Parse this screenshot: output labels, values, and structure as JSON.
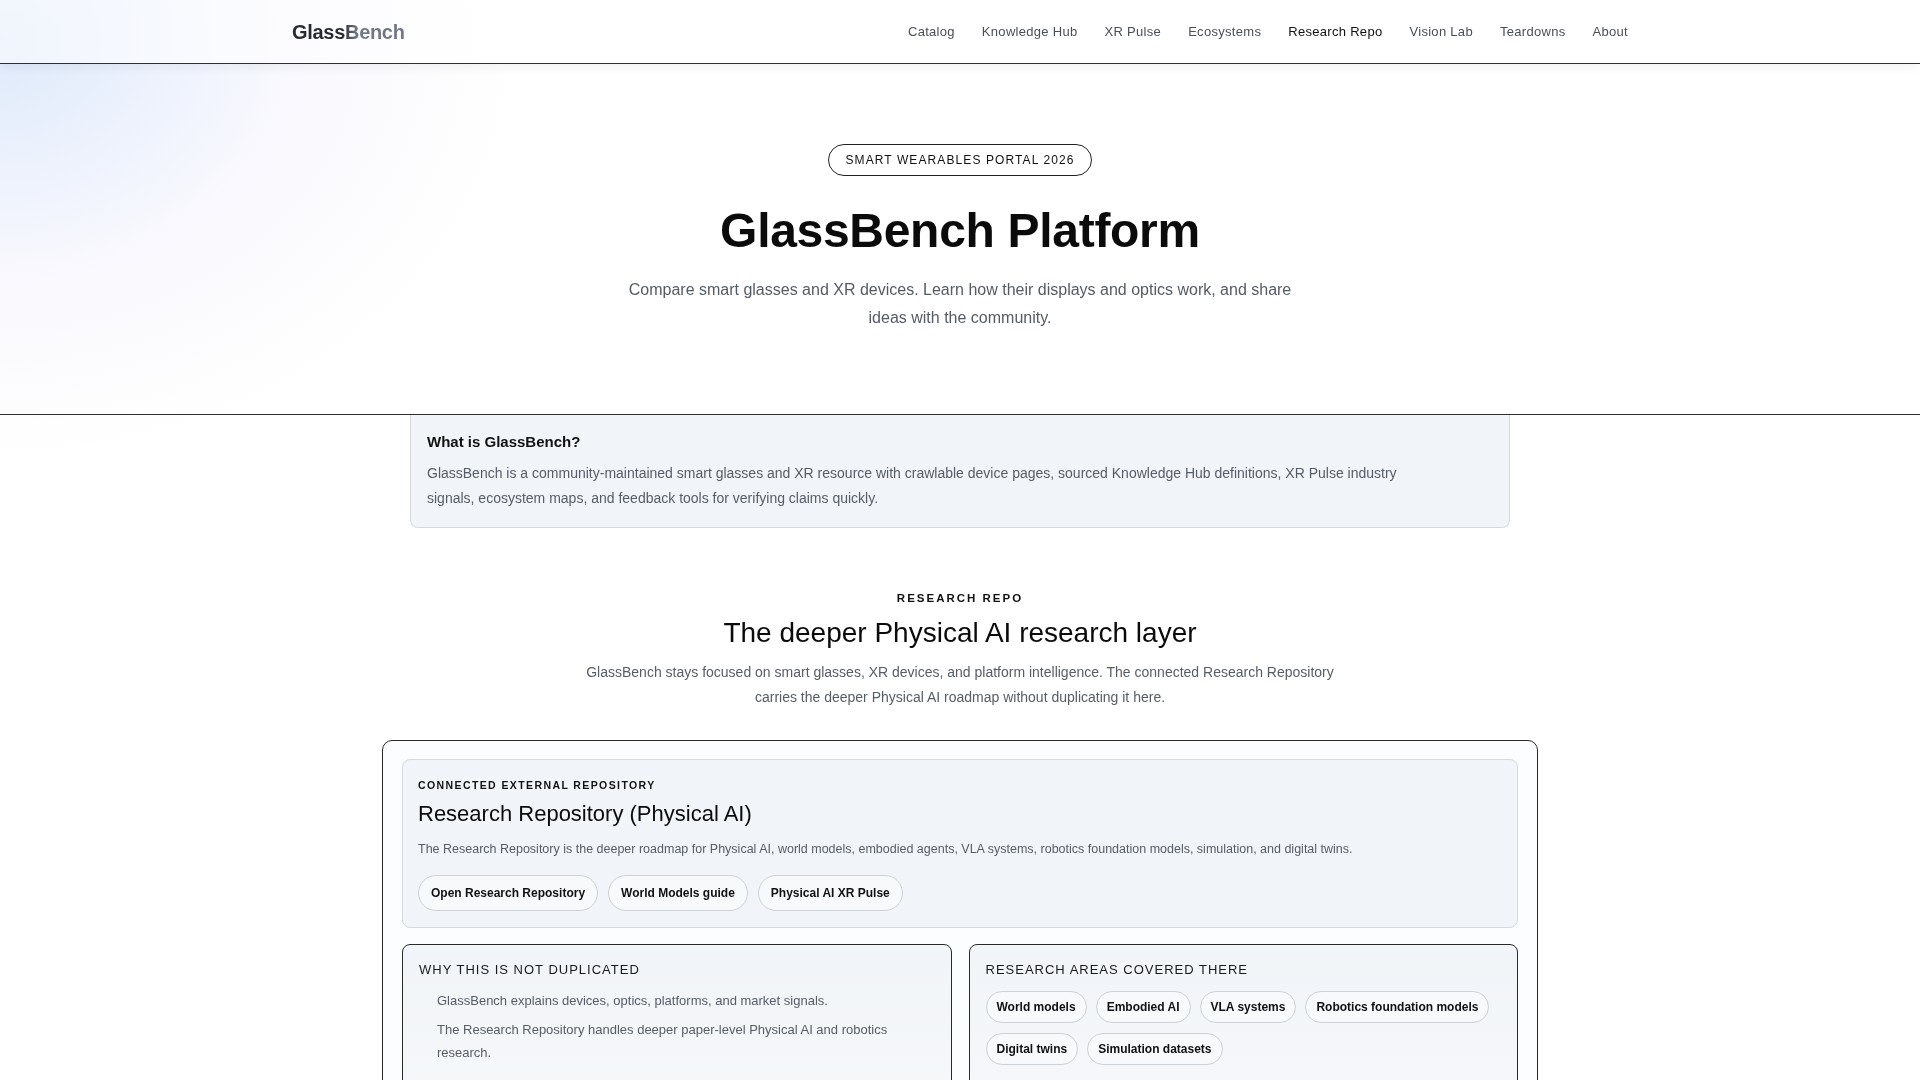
{
  "header": {
    "logo": "GlassBench",
    "nav": [
      {
        "label": "Catalog",
        "selected": false
      },
      {
        "label": "Knowledge Hub",
        "selected": false
      },
      {
        "label": "XR Pulse",
        "selected": false
      },
      {
        "label": "Ecosystems",
        "selected": false
      },
      {
        "label": "Research Repo",
        "selected": true
      },
      {
        "label": "Vision Lab",
        "selected": false
      },
      {
        "label": "Teardowns",
        "selected": false
      },
      {
        "label": "About",
        "selected": false
      }
    ]
  },
  "hero": {
    "badge": "SMART WEARABLES PORTAL 2026",
    "title": "GlassBench Platform",
    "subtitle": "Compare smart glasses and XR devices. Learn how their displays and optics work, and share ideas with the community."
  },
  "intro_card": {
    "title": "What is GlassBench?",
    "body": "GlassBench is a community-maintained smart glasses and XR resource with crawlable device pages, sourced Knowledge Hub definitions, XR Pulse industry signals, ecosystem maps, and feedback tools for verifying claims quickly."
  },
  "research_section": {
    "eyebrow": "RESEARCH REPO",
    "title": "The deeper Physical AI research layer",
    "description": "GlassBench stays focused on smart glasses, XR devices, and platform intelligence. The connected Research Repository carries the deeper Physical AI roadmap without duplicating it here.",
    "repository_card": {
      "eyebrow": "CONNECTED EXTERNAL REPOSITORY",
      "title": "Research Repository (Physical AI)",
      "description": "The Research Repository is the deeper roadmap for Physical AI, world models, embodied agents, VLA systems, robotics foundation models, simulation, and digital twins.",
      "links": [
        "Open Research Repository",
        "World Models guide",
        "Physical AI XR Pulse"
      ]
    },
    "not_duplicated": {
      "title": "WHY THIS IS NOT DUPLICATED",
      "items": [
        "GlassBench explains devices, optics, platforms, and market signals.",
        "The Research Repository handles deeper paper-level Physical AI and robotics research."
      ]
    },
    "research_areas": {
      "title": "RESEARCH AREAS COVERED THERE",
      "tags": [
        "World models",
        "Embodied AI",
        "VLA systems",
        "Robotics foundation models",
        "Digital twins",
        "Simulation datasets"
      ]
    }
  }
}
